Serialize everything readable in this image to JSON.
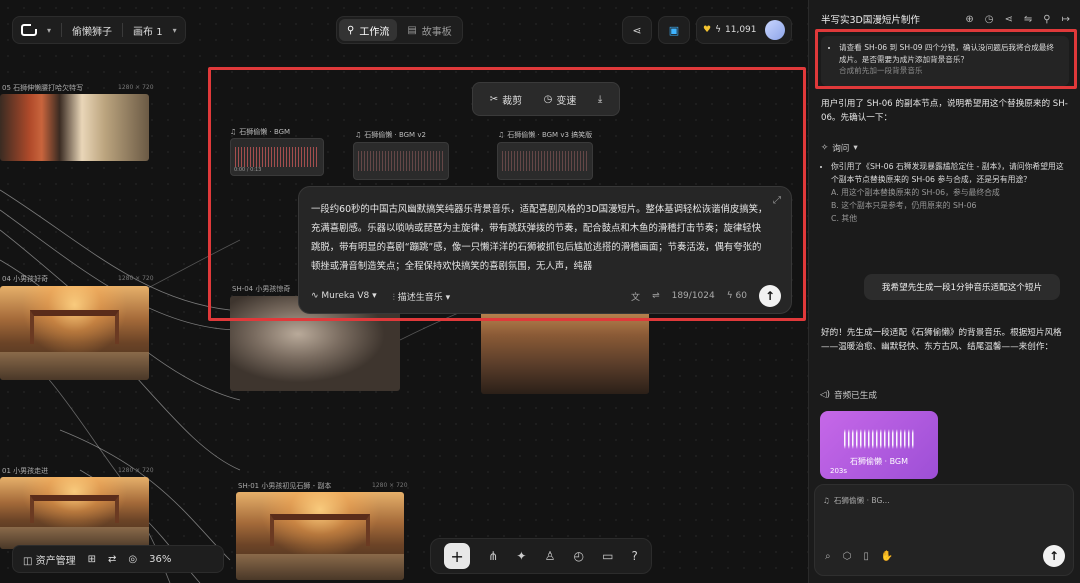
{
  "header": {
    "project_name": "偷懒狮子",
    "canvas_name": "画布 1",
    "tabs": [
      {
        "label": "工作流",
        "active": true
      },
      {
        "label": "故事板",
        "active": false
      }
    ],
    "credits": "11,091"
  },
  "nodes": [
    {
      "label": "05 石狮伸懒腰打哈欠特写",
      "size": "1280 × 720"
    },
    {
      "label": "04 小男孩好奇",
      "size": "1280 × 720"
    },
    {
      "label": "SH-04 小男孩惊奇",
      "size": ""
    },
    {
      "label": "01 小男孩走进",
      "size": "1280 × 720"
    },
    {
      "label": "SH-01 小男孩初见石狮 - 副本",
      "size": "1280 × 720"
    }
  ],
  "audio_nodes": [
    {
      "label": "石狮偷懒 · BGM",
      "time": "0:00 / 0:13"
    },
    {
      "label": "石狮偷懒 · BGM v2",
      "time": ""
    },
    {
      "label": "石狮偷懒 · BGM v3 搞笑版",
      "time": ""
    }
  ],
  "clip_toolbar": {
    "crop": "裁剪",
    "speed": "变速"
  },
  "prompt": {
    "text": "一段约60秒的中国古风幽默搞笑纯器乐背景音乐，适配喜剧风格的3D国漫短片。整体基调轻松诙谐俏皮搞笑，充满喜剧感。乐器以唢呐或琵琶为主旋律，带有跳跃弹拨的节奏，配合鼓点和木鱼的滑稽打击节奏；旋律轻快跳脱，带有明显的喜剧“蹦跳”感，像一只懒洋洋的石狮被抓包后尴尬逃搭的滑稽画面；节奏活泼，偶有夸张的顿挫或滑音制造笑点；全程保持欢快搞笑的喜剧氛围，无人声，纯器",
    "model": "Mureka V8",
    "mode": "描述生音乐",
    "count": "189/1024",
    "cost": "60"
  },
  "bottom_bar": {
    "assets": "资产管理",
    "zoom": "36%"
  },
  "panel": {
    "title": "半写实3D国漫短片制作",
    "msg1": "请查看 SH-06 到 SH-09 四个分镜，确认没问题后我将合成最终成片。是否需要为成片添加背景音乐？",
    "msg1_sub": "合成前先加一段背景音乐",
    "reply1": "用户引用了 SH-06 的副本节点，说明希望用这个替换原来的 SH-06。先确认一下：",
    "ask_label": "询问",
    "ask_q": "你引用了《SH-06 石狮发现暴露尴尬定住 - 副本》，请问你希望用这个副本节点替换原来的 SH-06 参与合成，还是另有用途？",
    "ask_opts": [
      "A. 用这个副本替换原来的 SH-06，参与最终合成",
      "B. 这个副本只是参考，仍用原来的 SH-06",
      "C. 其他"
    ],
    "user_msg": "我希望先生成一段1分钟音乐适配这个短片",
    "reply2": "好的！先生成一段适配《石狮偷懒》的背景音乐。根据短片风格——温暖治愈、幽默轻快、东方古风、结尾温馨——来创作：",
    "audio_done": "音频已生成",
    "music_title": "石狮偷懒 · BGM",
    "music_dur": "203s",
    "chip": "石狮偷懒 · BG..."
  },
  "colors": {
    "highlight": "#e0393a",
    "music_card": "#b45ce0"
  }
}
